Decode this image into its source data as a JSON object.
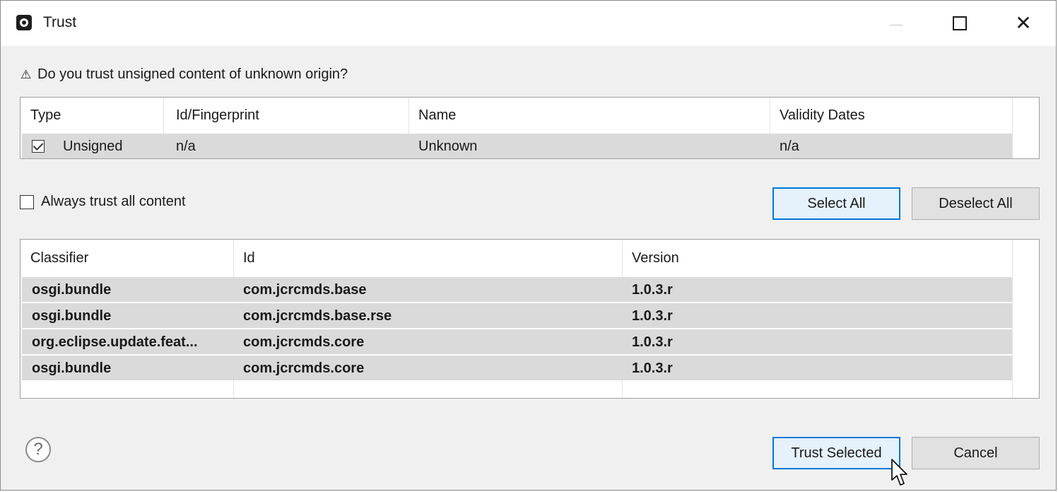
{
  "window": {
    "title": "Trust"
  },
  "question": {
    "icon": "⚠",
    "text": "Do you trust unsigned content of unknown origin?"
  },
  "cert_table": {
    "columns": [
      "Type",
      "Id/Fingerprint",
      "Name",
      "Validity Dates"
    ],
    "rows": [
      {
        "checked": true,
        "type": "Unsigned",
        "id": "n/a",
        "name": "Unknown",
        "validity": "n/a"
      }
    ]
  },
  "always_trust": {
    "label": "Always trust all content",
    "checked": false
  },
  "buttons": {
    "select_all": "Select All",
    "deselect_all": "Deselect All",
    "trust_selected": "Trust Selected",
    "cancel": "Cancel"
  },
  "bundle_table": {
    "columns": [
      "Classifier",
      "Id",
      "Version"
    ],
    "rows": [
      {
        "classifier": "osgi.bundle",
        "id": "com.jcrcmds.base",
        "version": "1.0.3.r"
      },
      {
        "classifier": "osgi.bundle",
        "id": "com.jcrcmds.base.rse",
        "version": "1.0.3.r"
      },
      {
        "classifier": "org.eclipse.update.feat...",
        "id": "com.jcrcmds.core",
        "version": "1.0.3.r"
      },
      {
        "classifier": "osgi.bundle",
        "id": "com.jcrcmds.core",
        "version": "1.0.3.r"
      }
    ]
  },
  "icons": {
    "app": "eclipse-icon",
    "minimize": "minimize-icon",
    "maximize": "maximize-icon",
    "close": "close-icon",
    "help": "help-icon",
    "cursor": "mouse-pointer-icon"
  },
  "colors": {
    "default_button_border": "#0078d7",
    "default_button_bg": "#e5f1fb",
    "selected_row_bg": "#dadada",
    "dialog_bg": "#f0f0f0"
  }
}
